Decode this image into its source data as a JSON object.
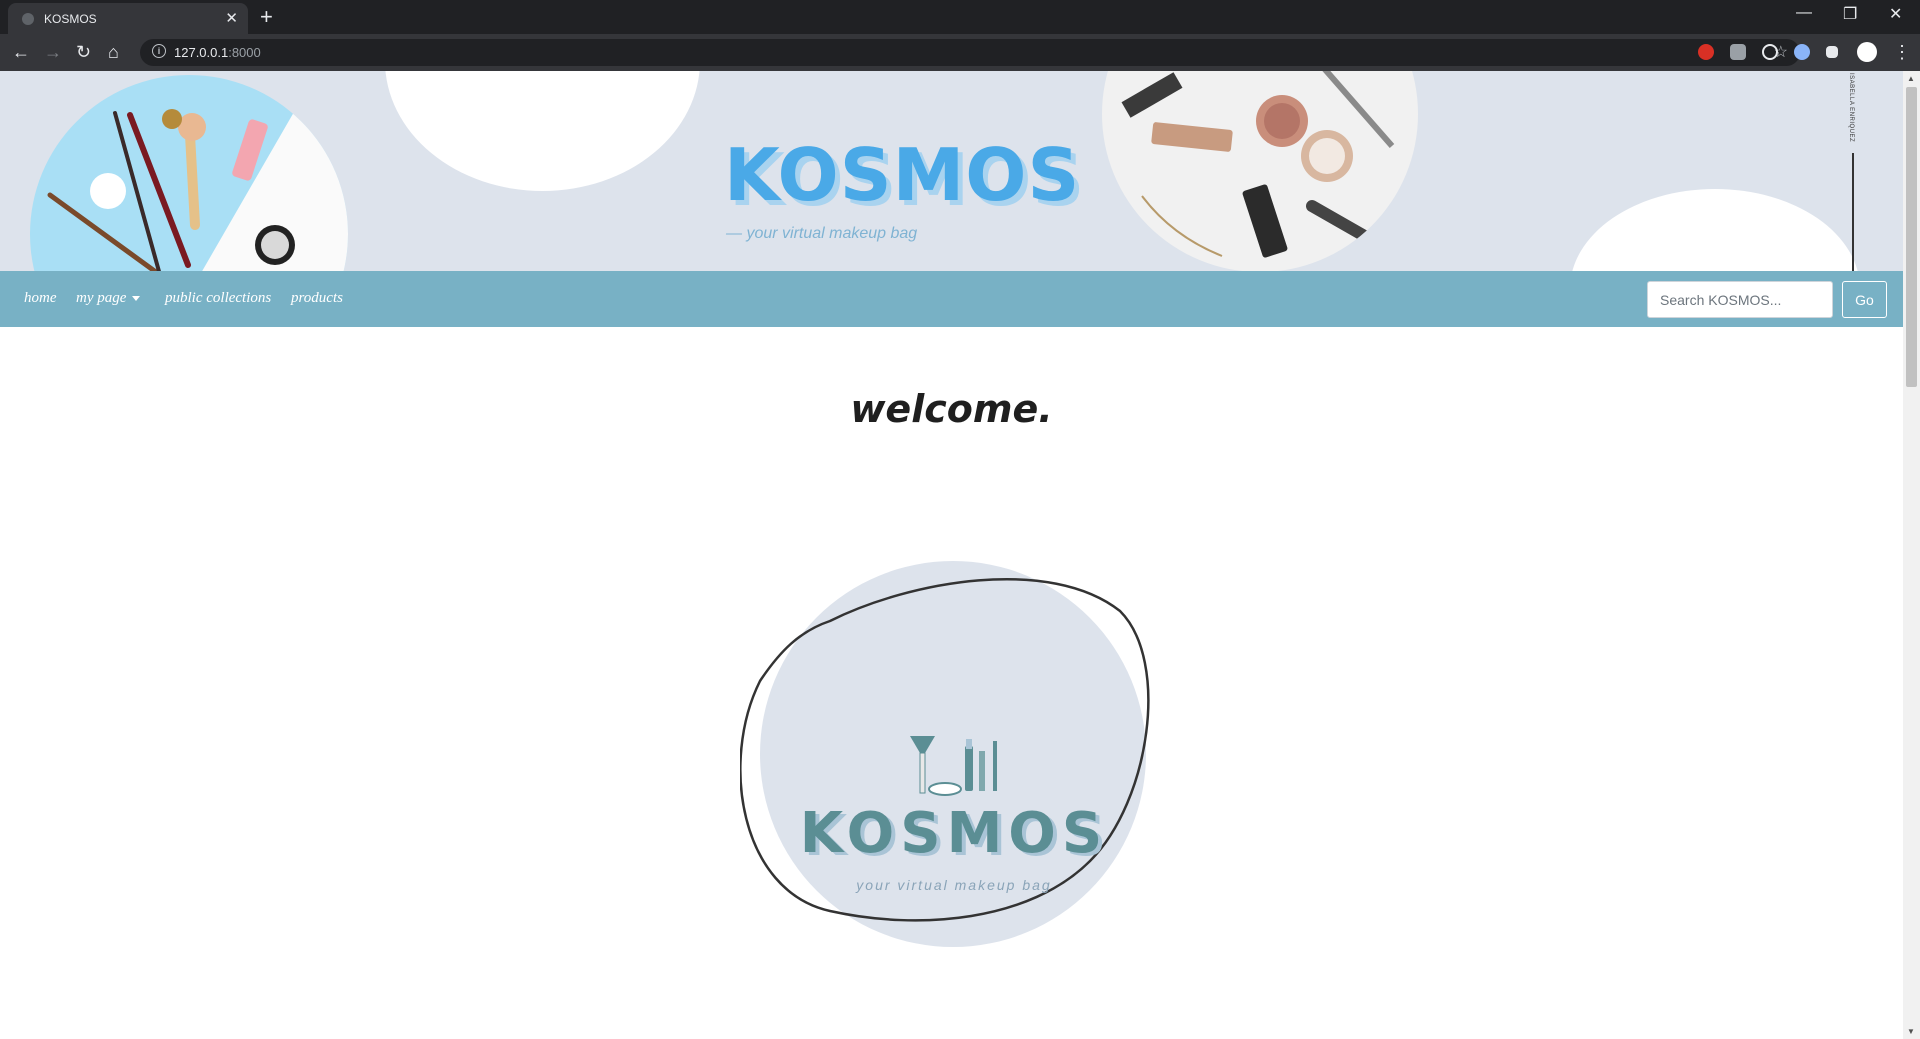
{
  "browser": {
    "tab_title": "KOSMOS",
    "url_host": "127.0.0.1",
    "url_port": ":8000"
  },
  "banner": {
    "title": "KOSMOS",
    "subtitle": "— your virtual makeup bag",
    "signature": "ISABELLA ENRIQUEZ"
  },
  "nav": {
    "home": "home",
    "my_page": "my page",
    "public_collections": "public collections",
    "products": "products",
    "search_placeholder": "Search KOSMOS...",
    "go_label": "Go"
  },
  "main": {
    "heading": "welcome.",
    "logo_title": "KOSMOS",
    "logo_subtitle": "your virtual makeup bag"
  },
  "colors": {
    "banner_bg": "#dde3ec",
    "navbar_bg": "#78b1c5",
    "brand_blue": "#4aa9e7",
    "logo_teal": "#5b8e94"
  }
}
